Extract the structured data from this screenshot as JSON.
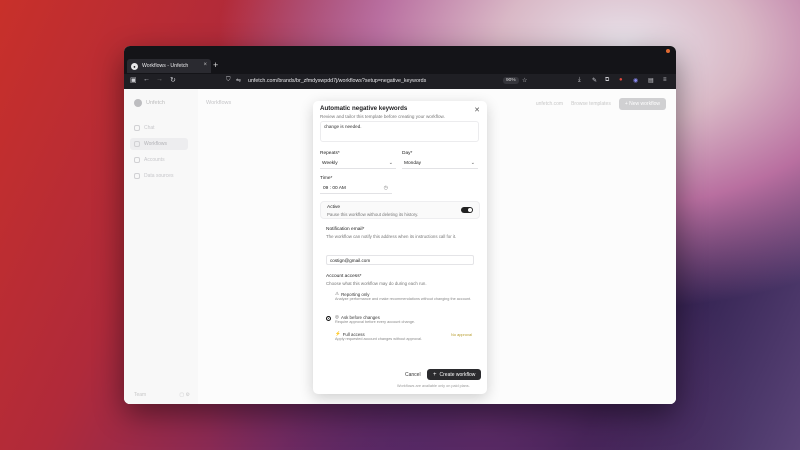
{
  "browser": {
    "tab_title": "Workflows - Unfetch",
    "tab_close": "×",
    "new_tab": "+",
    "address": "unfetch.com/brands/br_zfmdyswpdd7j/workflows?setup=negative_keywords",
    "zoom": "90%"
  },
  "app": {
    "brand": "Unfetch",
    "sidebar": [
      {
        "label": "Chat"
      },
      {
        "label": "Workflows"
      },
      {
        "label": "Accounts"
      },
      {
        "label": "Data sources"
      }
    ],
    "sidebar_footer": "Team",
    "page_title": "Workflows",
    "domain_chip": "unfetch.com",
    "browse_templates": "Browse templates",
    "new_workflow": "+ New workflow"
  },
  "modal": {
    "title": "Automatic negative keywords",
    "subtitle": "Review and tailor this template before creating your workflow.",
    "instructions_value": "change is needed.",
    "repeats_label": "Repeats",
    "repeats_value": "Weekly",
    "day_label": "Day",
    "day_value": "Monday",
    "time_label": "Time",
    "time_value": "09 : 00   AM",
    "required": "*",
    "active_title": "Active",
    "active_desc": "Pause this workflow without deleting its history.",
    "email_label": "Notification email",
    "email_desc": "The workflow can notify this address when its instructions call for it.",
    "email_value": "costign@gmail.com",
    "access_label": "Account access",
    "access_desc": "Choose what this workflow may do during each run.",
    "options": [
      {
        "title": "Reporting only",
        "desc": "Analyze performance and make recommendations without changing the account.",
        "badge": ""
      },
      {
        "title": "Ask before changes",
        "desc": "Require approval before every account change.",
        "badge": ""
      },
      {
        "title": "Full access",
        "desc": "Apply requested account changes without approval.",
        "badge": "No approval"
      }
    ],
    "cancel": "Cancel",
    "create": "Create workflow",
    "footnote": "Workflows are available only on paid plans."
  }
}
